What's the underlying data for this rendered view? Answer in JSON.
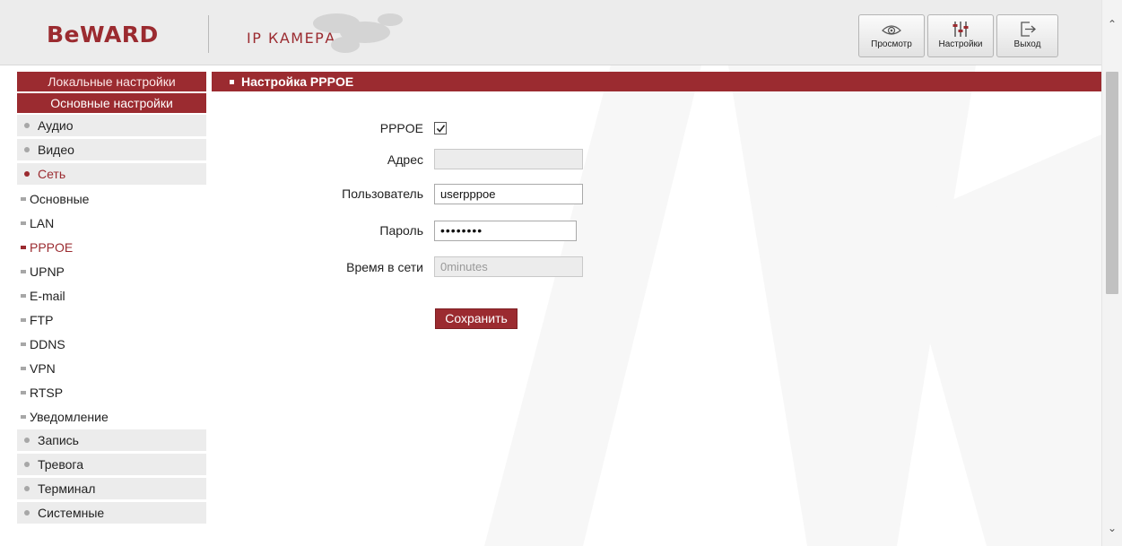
{
  "header": {
    "logo": "BeWARD",
    "product": "IP КАМЕРА",
    "buttons": {
      "view": "Просмотр",
      "settings": "Настройки",
      "exit": "Выход"
    }
  },
  "sidebar": {
    "local_settings": "Локальные настройки",
    "main_settings": "Основные настройки",
    "groups_top": [
      {
        "label": "Аудио"
      },
      {
        "label": "Видео"
      },
      {
        "label": "Сеть"
      }
    ],
    "network_items": [
      {
        "label": "Основные"
      },
      {
        "label": "LAN"
      },
      {
        "label": "PPPOE"
      },
      {
        "label": "UPNP"
      },
      {
        "label": "E-mail"
      },
      {
        "label": "FTP"
      },
      {
        "label": "DDNS"
      },
      {
        "label": "VPN"
      },
      {
        "label": "RTSP"
      },
      {
        "label": "Уведомление"
      }
    ],
    "groups_bottom": [
      {
        "label": "Запись"
      },
      {
        "label": "Тревога"
      },
      {
        "label": "Терминал"
      },
      {
        "label": "Системные"
      }
    ]
  },
  "main": {
    "section_title": "Настройка PPPOE",
    "form": {
      "pppoe_label": "PPPOE",
      "pppoe_checked": true,
      "address_label": "Адрес",
      "address_value": "",
      "user_label": "Пользователь",
      "user_value": "userpppoe",
      "password_label": "Пароль",
      "password_value": "••••••••",
      "online_time_label": "Время в сети",
      "online_time_value": "0minutes"
    },
    "save_label": "Сохранить"
  },
  "colors": {
    "accent": "#9b2b30",
    "header_bg": "#ececec",
    "sidebar_item_bg": "#ececec"
  }
}
